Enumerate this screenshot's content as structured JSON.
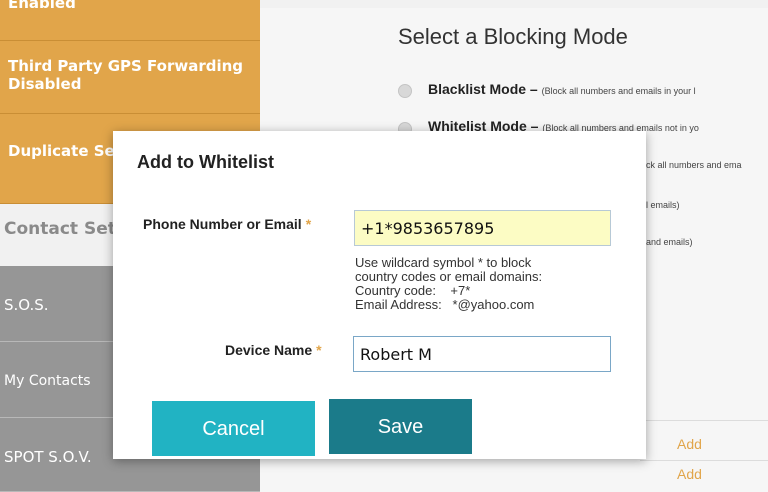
{
  "sidebar": {
    "items": [
      {
        "label": "Enabled"
      },
      {
        "label_lines": [
          "Third Party GPS Forwarding",
          "Disabled"
        ]
      },
      {
        "label": "Duplicate Set"
      },
      {
        "label": "Contact Setti"
      },
      {
        "label": "S.O.S."
      },
      {
        "label": "My Contacts"
      },
      {
        "label": "SPOT S.O.V."
      }
    ]
  },
  "blocking": {
    "title": "Select a Blocking Mode",
    "options": [
      {
        "label": "Blacklist Mode –",
        "desc": "(Block all numbers and emails in your l"
      },
      {
        "label": "Whitelist Mode –",
        "desc": "(Block all numbers and emails not in yo"
      }
    ],
    "obscured_lines": [
      "ck all numbers and ema",
      "l emails)",
      "and emails)"
    ]
  },
  "contacts_section": {
    "heading_fragment": "S",
    "add_links": [
      "Add",
      "Add"
    ]
  },
  "dialog": {
    "title": "Add to Whitelist",
    "phone_label": "Phone Number or Email",
    "phone_value": "+1*9853657895",
    "hint_lines": [
      "Use wildcard symbol * to block",
      "country codes or email domains:",
      "Country code:    +7*",
      "Email Address:   *@yahoo.com"
    ],
    "device_label": "Device Name",
    "device_value": "Robert M",
    "required_mark": "*",
    "cancel_label": "Cancel",
    "save_label": "Save"
  },
  "colors": {
    "sidebar_orange": "#e1a54a",
    "sidebar_gray": "#969696",
    "cancel_button": "#21b3c3",
    "save_button": "#1b7b8a",
    "phone_input_bg": "#fcfcc4",
    "required_star": "#e1a54a"
  }
}
